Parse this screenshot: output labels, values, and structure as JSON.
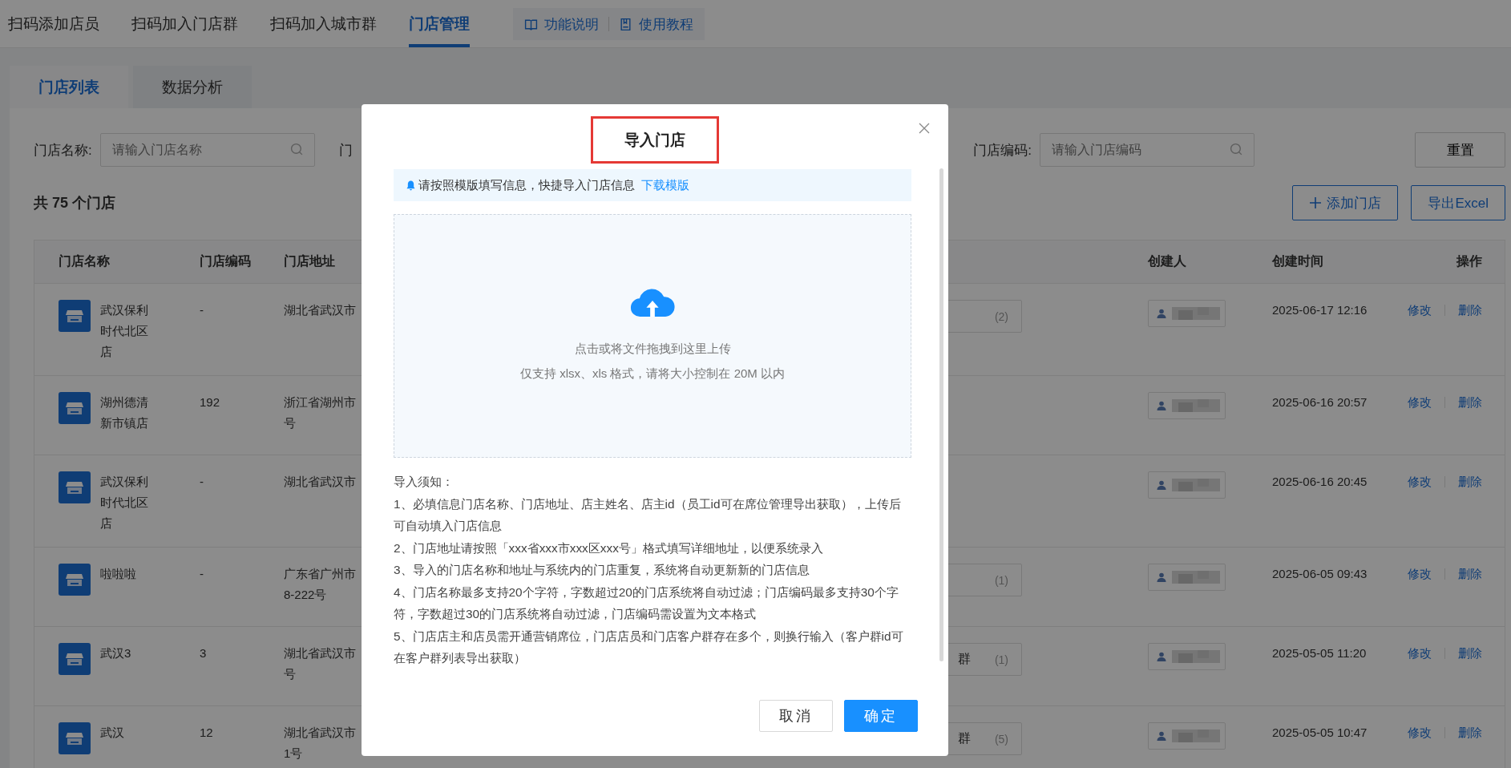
{
  "top_nav": {
    "tabs": [
      {
        "label": "扫码添加店员",
        "selected": false
      },
      {
        "label": "扫码加入门店群",
        "selected": false
      },
      {
        "label": "扫码加入城市群",
        "selected": false
      },
      {
        "label": "门店管理",
        "selected": true
      }
    ],
    "help_links": [
      {
        "label": "功能说明",
        "kind": "book"
      },
      {
        "label": "使用教程",
        "kind": "doc"
      }
    ]
  },
  "sub_tabs": [
    {
      "label": "门店列表",
      "selected": true
    },
    {
      "label": "数据分析",
      "selected": false
    }
  ],
  "name_filter": {
    "label": "门店名称:",
    "placeholder": "请输入门店名称"
  },
  "cut_filter_label": "门",
  "code_filter": {
    "label": "门店编码:",
    "placeholder": "请输入门店编码"
  },
  "reset_button": "重置",
  "store_count": "共 75 个门店",
  "add_button": "添加门店",
  "export_button": "导出Excel",
  "table": {
    "columns": [
      "门店名称",
      "门店编码",
      "门店地址",
      "创建人",
      "创建时间",
      "操作"
    ],
    "rows": [
      {
        "name": "武汉保利时代北区店",
        "code": "-",
        "address": [
          "湖北省武汉市"
        ],
        "tag": {
          "count": "(2)"
        },
        "created_at": "2025-06-17 12:16",
        "actions": [
          "修改",
          "删除"
        ]
      },
      {
        "name": "湖州德清新市镇店",
        "code": "192",
        "address": [
          "浙江省湖州市",
          "号"
        ],
        "created_at": "2025-06-16 20:57",
        "actions": [
          "修改",
          "删除"
        ]
      },
      {
        "name": "武汉保利时代北区店",
        "code": "-",
        "address": [
          "湖北省武汉市"
        ],
        "created_at": "2025-06-16 20:45",
        "actions": [
          "修改",
          "删除"
        ]
      },
      {
        "name": "啦啦啦",
        "code": "-",
        "address": [
          "广东省广州市",
          "8-222号"
        ],
        "tag": {
          "count": "(1)"
        },
        "created_at": "2025-06-05 09:43",
        "actions": [
          "修改",
          "删除"
        ]
      },
      {
        "name": "武汉3",
        "code": "3",
        "address": [
          "湖北省武汉市",
          "号"
        ],
        "tag": {
          "text": "群",
          "count": "(1)"
        },
        "created_at": "2025-05-05 11:20",
        "actions": [
          "修改",
          "删除"
        ]
      },
      {
        "name": "武汉",
        "code": "12",
        "address": [
          "湖北省武汉市",
          "1号"
        ],
        "tag": {
          "text": "群",
          "count": "(5)"
        },
        "created_at": "2025-05-05 10:47",
        "actions": [
          "修改",
          "删除"
        ]
      }
    ]
  },
  "modal": {
    "title": "导入门店",
    "title_highlighted": true,
    "notice": {
      "text": "请按照模版填写信息，快捷导入门店信息",
      "link": "下载模版"
    },
    "upload": {
      "hint": "点击或将文件拖拽到这里上传",
      "note": "仅支持 xlsx、xls 格式，请将大小控制在 20M 以内"
    },
    "notes": {
      "title": "导入须知：",
      "items": [
        "1、必填信息门店名称、门店地址、店主姓名、店主id（员工id可在席位管理导出获取），上传后可自动填入门店信息",
        "2、门店地址请按照「xxx省xxx市xxx区xxx号」格式填写详细地址，以便系统录入",
        "3、导入的门店名称和地址与系统内的门店重复，系统将自动更新新的门店信息",
        "4、门店名称最多支持20个字符，字数超过20的门店系统将自动过滤；门店编码最多支持30个字符，字数超过30的门店系统将自动过滤，门店编码需设置为文本格式",
        "5、门店店主和店员需开通营销席位，门店店员和门店客户群存在多个，则换行输入（客户群id可在客户群列表导出获取）"
      ]
    },
    "buttons": [
      {
        "label": "取消",
        "kind": "secondary"
      },
      {
        "label": "确定",
        "kind": "primary"
      }
    ]
  }
}
